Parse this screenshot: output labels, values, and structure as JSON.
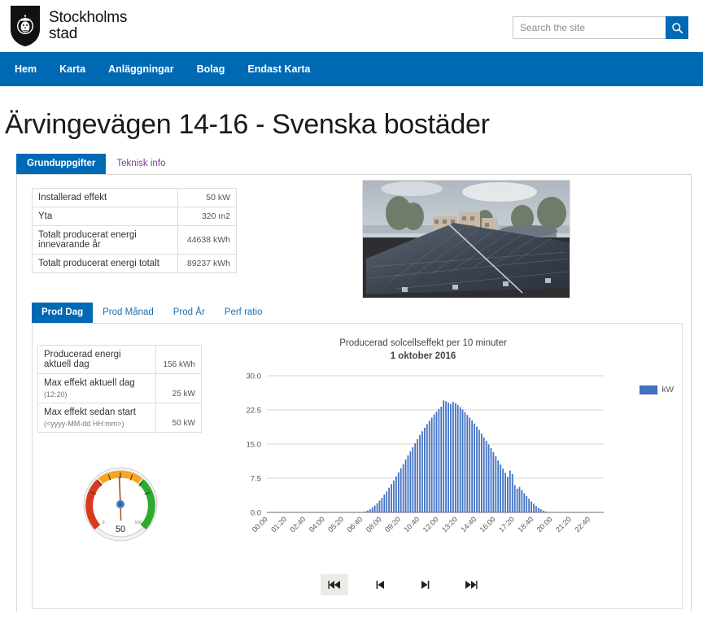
{
  "header": {
    "logo_line1": "Stockholms",
    "logo_line2": "stad",
    "logo_icon": "stockholm-crest-icon",
    "search_placeholder": "Search the site",
    "search_value": "",
    "search_icon": "search-icon"
  },
  "nav": {
    "items": [
      {
        "label": "Hem"
      },
      {
        "label": "Karta"
      },
      {
        "label": "Anläggningar"
      },
      {
        "label": "Bolag"
      },
      {
        "label": "Endast Karta"
      }
    ],
    "bg_color": "#0069b4"
  },
  "title": "Ärvingevägen 14-16 - Svenska bostäder",
  "main_tabs": [
    {
      "label": "Grunduppgifter",
      "active": true
    },
    {
      "label": "Teknisk info",
      "active": false
    }
  ],
  "info_table": {
    "rows": [
      {
        "label": "Installerad effekt",
        "value": "50 kW"
      },
      {
        "label": "Yta",
        "value": "320 m2"
      },
      {
        "label": "Totalt producerat energi innevarande år",
        "value": "44638 kWh"
      },
      {
        "label": "Totalt producerat energi totalt",
        "value": "89237 kWh"
      }
    ]
  },
  "photo": {
    "alt": "Solpaneler på tak"
  },
  "prod_tabs": [
    {
      "label": "Prod Dag",
      "active": true
    },
    {
      "label": "Prod Månad",
      "active": false
    },
    {
      "label": "Prod År",
      "active": false
    },
    {
      "label": "Perf ratio",
      "active": false
    }
  ],
  "metrics": {
    "rows": [
      {
        "label": "Producerad energi aktuell dag",
        "sub": "",
        "value": "156 kWh"
      },
      {
        "label": "Max effekt aktuell dag",
        "sub": "(12:20)",
        "value": "25 kW"
      },
      {
        "label": "Max effekt sedan start",
        "sub": "(<yyyy-MM-dd HH:mm>)",
        "value": "50 kW"
      }
    ]
  },
  "gauge": {
    "value": 50,
    "value_label": "50",
    "min_label": "0",
    "max_label": "100",
    "min": 0,
    "max": 100,
    "color_low": "#d93a1e",
    "color_mid": "#f5a623",
    "color_high": "#2faa2f"
  },
  "controls": [
    {
      "icon": "skip-first-icon",
      "hover": true
    },
    {
      "icon": "step-prev-icon",
      "hover": false
    },
    {
      "icon": "step-next-icon",
      "hover": false
    },
    {
      "icon": "skip-last-icon",
      "hover": false
    }
  ],
  "chart_data": {
    "type": "bar",
    "title": "Producerad solcellseffekt per 10 minuter",
    "subtitle": "1 oktober 2016",
    "xlabel": "",
    "ylabel": "",
    "ylim": [
      0,
      30
    ],
    "yticks": [
      0.0,
      7.5,
      15.0,
      22.5,
      30.0
    ],
    "ytick_labels": [
      "0.0",
      "7.5",
      "15.0",
      "22.5",
      "30.0"
    ],
    "grid": true,
    "legend": [
      {
        "name": "kW",
        "color": "#4472c4"
      }
    ],
    "legend_position": "right",
    "bar_color": "#4472c4",
    "xtick_labels": [
      "00:00",
      "01:20",
      "02:40",
      "04:00",
      "05:20",
      "06:40",
      "08:00",
      "09:20",
      "10:40",
      "12:00",
      "13:20",
      "14:40",
      "16:00",
      "17:20",
      "18:40",
      "20:00",
      "21:20",
      "22:40"
    ],
    "xtick_step_minutes": 80,
    "interval_minutes": 10,
    "x": [
      "00:00",
      "00:10",
      "00:20",
      "00:30",
      "00:40",
      "00:50",
      "01:00",
      "01:10",
      "01:20",
      "01:30",
      "01:40",
      "01:50",
      "02:00",
      "02:10",
      "02:20",
      "02:30",
      "02:40",
      "02:50",
      "03:00",
      "03:10",
      "03:20",
      "03:30",
      "03:40",
      "03:50",
      "04:00",
      "04:10",
      "04:20",
      "04:30",
      "04:40",
      "04:50",
      "05:00",
      "05:10",
      "05:20",
      "05:30",
      "05:40",
      "05:50",
      "06:00",
      "06:10",
      "06:20",
      "06:30",
      "06:40",
      "06:50",
      "07:00",
      "07:10",
      "07:20",
      "07:30",
      "07:40",
      "07:50",
      "08:00",
      "08:10",
      "08:20",
      "08:30",
      "08:40",
      "08:50",
      "09:00",
      "09:10",
      "09:20",
      "09:30",
      "09:40",
      "09:50",
      "10:00",
      "10:10",
      "10:20",
      "10:30",
      "10:40",
      "10:50",
      "11:00",
      "11:10",
      "11:20",
      "11:30",
      "11:40",
      "11:50",
      "12:00",
      "12:10",
      "12:20",
      "12:30",
      "12:40",
      "12:50",
      "13:00",
      "13:10",
      "13:20",
      "13:30",
      "13:40",
      "13:50",
      "14:00",
      "14:10",
      "14:20",
      "14:30",
      "14:40",
      "14:50",
      "15:00",
      "15:10",
      "15:20",
      "15:30",
      "15:40",
      "15:50",
      "16:00",
      "16:10",
      "16:20",
      "16:30",
      "16:40",
      "16:50",
      "17:00",
      "17:10",
      "17:20",
      "17:30",
      "17:40",
      "17:50",
      "18:00",
      "18:10",
      "18:20",
      "18:30",
      "18:40",
      "18:50",
      "19:00",
      "19:10",
      "19:20",
      "19:30",
      "19:40",
      "19:50",
      "20:00",
      "20:10",
      "20:20",
      "20:30",
      "20:40",
      "20:50",
      "21:00",
      "21:10",
      "21:20",
      "21:30",
      "21:40",
      "21:50",
      "22:00",
      "22:10",
      "22:20",
      "22:30",
      "22:40",
      "22:50",
      "23:00",
      "23:10",
      "23:20",
      "23:30",
      "23:40",
      "23:50"
    ],
    "values": [
      0,
      0,
      0,
      0,
      0,
      0,
      0,
      0,
      0,
      0,
      0,
      0,
      0,
      0,
      0,
      0,
      0,
      0,
      0,
      0,
      0,
      0,
      0,
      0,
      0,
      0,
      0,
      0,
      0,
      0,
      0,
      0,
      0,
      0,
      0,
      0,
      0,
      0,
      0,
      0,
      0.1,
      0.2,
      0.4,
      0.7,
      1.1,
      1.5,
      2.0,
      2.6,
      3.2,
      3.9,
      4.6,
      5.4,
      6.2,
      7.0,
      7.9,
      8.8,
      9.7,
      10.6,
      11.6,
      12.5,
      13.4,
      14.3,
      15.2,
      16.1,
      17.0,
      17.8,
      18.6,
      19.4,
      20.1,
      20.8,
      21.5,
      22.1,
      22.7,
      23.2,
      24.6,
      24.4,
      24.1,
      23.8,
      24.3,
      24.0,
      23.6,
      23.1,
      22.6,
      22.0,
      21.4,
      20.8,
      20.2,
      19.5,
      18.8,
      18.1,
      17.3,
      16.5,
      15.7,
      14.9,
      14.1,
      13.2,
      12.3,
      11.4,
      10.5,
      9.6,
      8.7,
      7.8,
      9.2,
      8.4,
      6.0,
      5.2,
      5.6,
      4.9,
      4.2,
      3.6,
      3.0,
      2.4,
      1.9,
      1.4,
      1.0,
      0.7,
      0.4,
      0.2,
      0.1,
      0,
      0,
      0,
      0,
      0,
      0,
      0,
      0,
      0,
      0,
      0,
      0,
      0,
      0,
      0,
      0,
      0,
      0,
      0,
      0,
      0,
      0,
      0
    ]
  }
}
